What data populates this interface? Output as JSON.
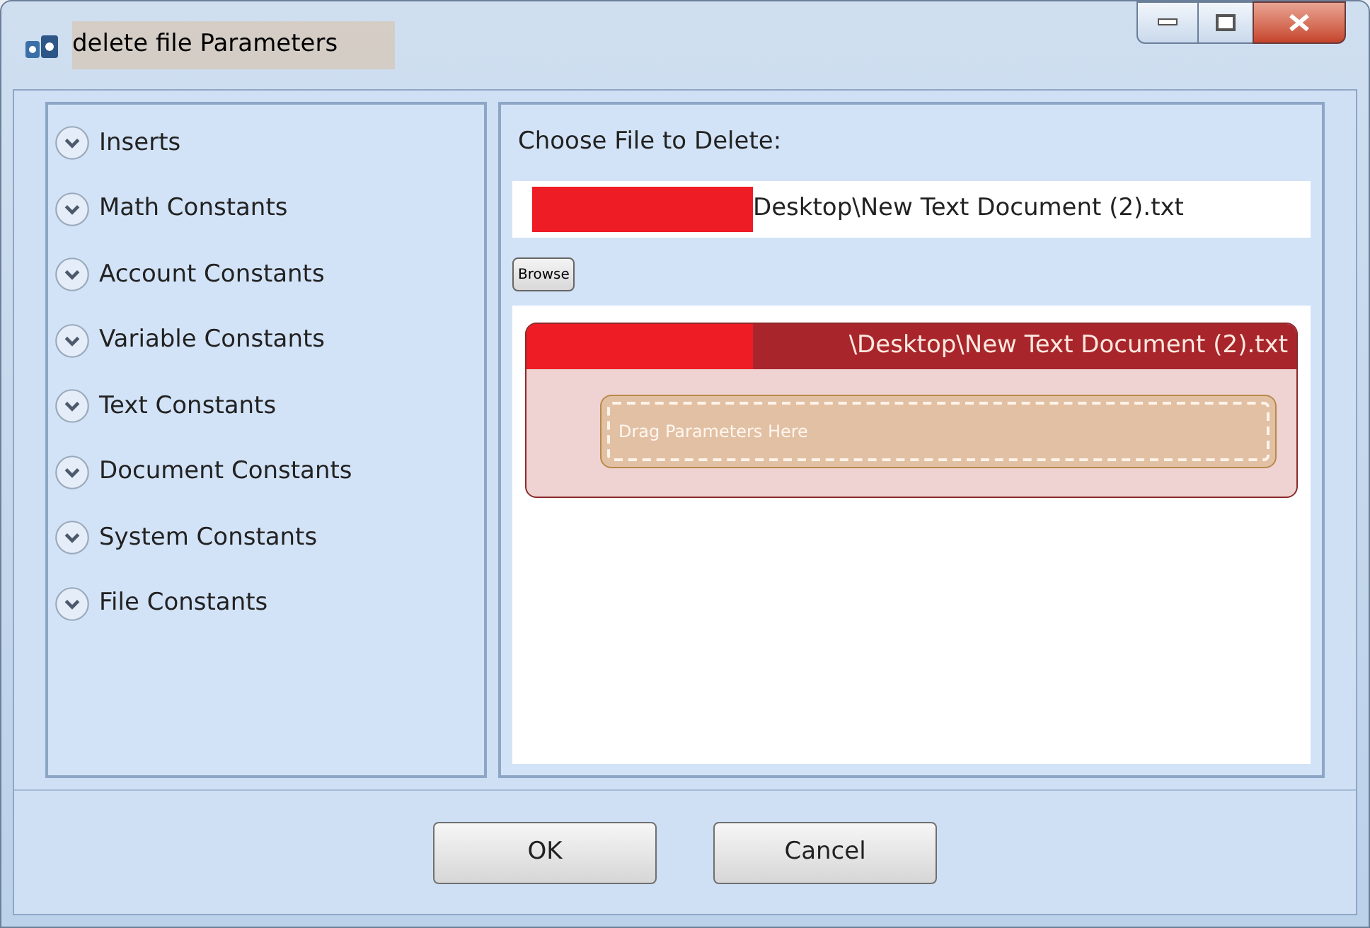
{
  "window": {
    "title": "delete file Parameters"
  },
  "categories": [
    {
      "label": "Inserts",
      "expanded": false
    },
    {
      "label": "Math Constants",
      "expanded": false
    },
    {
      "label": "Account Constants",
      "expanded": false
    },
    {
      "label": "Variable Constants",
      "expanded": false
    },
    {
      "label": "Text Constants",
      "expanded": false
    },
    {
      "label": "Document Constants",
      "expanded": false
    },
    {
      "label": "System Constants",
      "expanded": false
    },
    {
      "label": "File Constants",
      "expanded": false
    }
  ],
  "file_panel": {
    "label": "Choose File to Delete:",
    "path_value": "Desktop\\New Text Document (2).txt",
    "browse_button": "Browse"
  },
  "parameter_block": {
    "title": "\\Desktop\\New Text Document (2).txt",
    "drop_zone": "Drag Parameters Here"
  },
  "buttons": [
    "OK",
    "Cancel"
  ]
}
